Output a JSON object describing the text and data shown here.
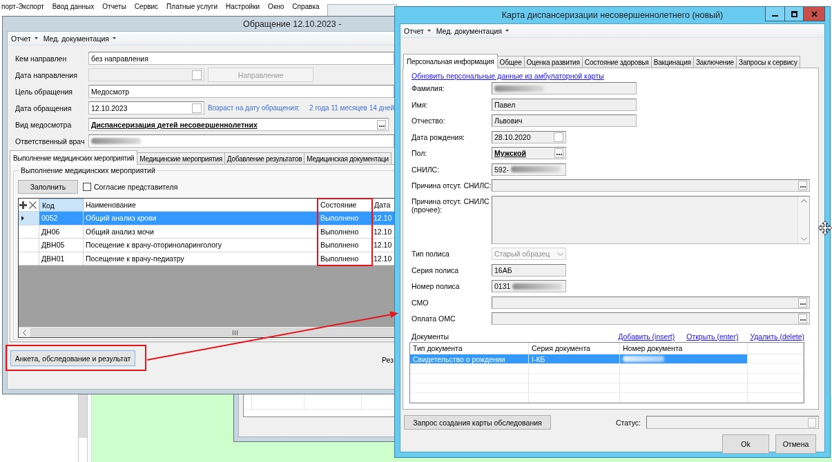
{
  "menu_bar": {
    "items": [
      "порт-Экспорт",
      "Ввод данных",
      "Отчеты",
      "Сервис",
      "Платные услуги",
      "Настройки",
      "Окно",
      "Справка"
    ]
  },
  "appeal_window": {
    "title": "Обращение 12.10.2023 -",
    "toolbar": [
      "Отчет",
      "Мед. документация"
    ],
    "form": [
      {
        "kind": "text",
        "label": "Кем направлен",
        "value": "без направления",
        "disabled": false
      },
      {
        "kind": "date",
        "label": "Дата направления",
        "disabled": true,
        "button": {
          "label": "Направление",
          "disabled": true
        }
      },
      {
        "kind": "text",
        "label": "Цель обращения",
        "value": "Медосмотр",
        "disabled": false
      },
      {
        "kind": "date",
        "label": "Дата обращения",
        "value": "12.10.2023",
        "disabled": false,
        "age_label": "Возраст на дату обращения:",
        "age_value": "2 года 11 месяцев 14 дней"
      },
      {
        "kind": "lookup",
        "label": "Вид медосмотра",
        "value": "Диспансеризация детей несовершеннолетних",
        "disabled": false
      },
      {
        "kind": "text",
        "label": "Ответственный врач",
        "disabled": false,
        "redacted": true
      }
    ],
    "tabs": [
      {
        "label": "Выполнение медицинских мероприятий",
        "selected": true
      },
      {
        "label": "Медицинские мероприятия",
        "selected": false
      },
      {
        "label": "Добавление результатов",
        "selected": false
      },
      {
        "label": "Медицинская документаци",
        "selected": false
      }
    ],
    "group_title": "Выполнение медицинских мероприятий",
    "fill_button": "Заполнить",
    "consent": {
      "label": "Согласие представителя",
      "checked": false
    },
    "table": {
      "columns": [
        {
          "label": "Код",
          "selected": true,
          "highlighted": false
        },
        {
          "label": "Наименование",
          "selected": false,
          "highlighted": false
        },
        {
          "label": "Состояние",
          "selected": false,
          "highlighted": true
        },
        {
          "label": "Дата",
          "selected": false,
          "highlighted": false
        }
      ],
      "rows": [
        {
          "cells": [
            "0052",
            "Общий анализ крови",
            "Выполнено",
            "12.10"
          ],
          "selected": true
        },
        {
          "cells": [
            "ДН06",
            "Общий анализ мочи",
            "Выполнено",
            "12.10"
          ],
          "selected": false
        },
        {
          "cells": [
            "ДВН05",
            "Посещение к врачу-оториноларингологу",
            "Выполнено",
            "12.10"
          ],
          "selected": false
        },
        {
          "cells": [
            "ДВН01",
            "Посещение к врачу-педиатру",
            "Выполнено",
            "12.10"
          ],
          "selected": false
        }
      ]
    },
    "footer_button": {
      "label": "Анкета, обследование и результат",
      "highlighted": true
    },
    "footer_text": "Рез"
  },
  "annotation_arrow": true,
  "card_window": {
    "title": "Карта диспансеризации несовершеннолетнего (новый)",
    "toolbar": [
      "Отчет",
      "Мед. документация"
    ],
    "tabs": [
      {
        "label": "Персональная информация",
        "selected": true
      },
      {
        "label": "Общее",
        "selected": false
      },
      {
        "label": "Оценка развития",
        "selected": false
      },
      {
        "label": "Состояние здоровья",
        "selected": false
      },
      {
        "label": "Вакцинация",
        "selected": false
      },
      {
        "label": "Заключение",
        "selected": false
      },
      {
        "label": "Запросы к сервису",
        "selected": false
      }
    ],
    "refresh_link": "Обновить персональные данные из амбулаторной карты",
    "fields": [
      {
        "kind": "name",
        "label": "Фамилия:",
        "disabled": false,
        "redacted": true
      },
      {
        "kind": "name",
        "label": "Имя:",
        "value": "Павел",
        "disabled": false
      },
      {
        "kind": "name",
        "label": "Отчество:",
        "value": "Львович",
        "disabled": false
      },
      {
        "kind": "date",
        "label": "Дата рождения:",
        "value": "28.10.2020",
        "disabled": false
      },
      {
        "kind": "choice",
        "label": "Пол:",
        "value": "Мужской",
        "disabled": false
      },
      {
        "kind": "code",
        "label": "СНИЛС:",
        "value": "592-",
        "disabled": false,
        "redacted": true
      },
      {
        "kind": "lookup",
        "label": "Причина отсут. СНИЛС:",
        "disabled": false
      },
      {
        "kind": "memo",
        "label": "Причина отсут. СНИЛС (прочее):",
        "disabled": false
      },
      {
        "kind": "select",
        "label": "Тип полиса",
        "value": "Старый образец",
        "disabled": true
      },
      {
        "kind": "code",
        "label": "Серия полиса",
        "value": "16АБ",
        "disabled": false
      },
      {
        "kind": "code",
        "label": "Номер полиса",
        "value": "0131",
        "disabled": false,
        "redacted": true
      },
      {
        "kind": "lookup",
        "label": "СМО",
        "disabled": false
      },
      {
        "kind": "lookup",
        "label": "Оплата ОМС",
        "disabled": false
      }
    ],
    "documents": {
      "label": "Документы",
      "actions": [
        "Добавить (insert)",
        "Открыть (enter)",
        "Удалить (delete)"
      ],
      "columns": [
        "Тип документа",
        "Серия документа",
        "Номер документа"
      ],
      "rows": [
        {
          "cells": [
            {
              "text": "Свидетельство о рождении"
            },
            {
              "text": "I-КБ"
            },
            {
              "redacted": true
            }
          ],
          "selected": true
        }
      ]
    },
    "request_button": "Запрос создания карты обследования",
    "status": {
      "label": "Статус:"
    },
    "buttons": [
      "Ok",
      "Отмена"
    ]
  }
}
